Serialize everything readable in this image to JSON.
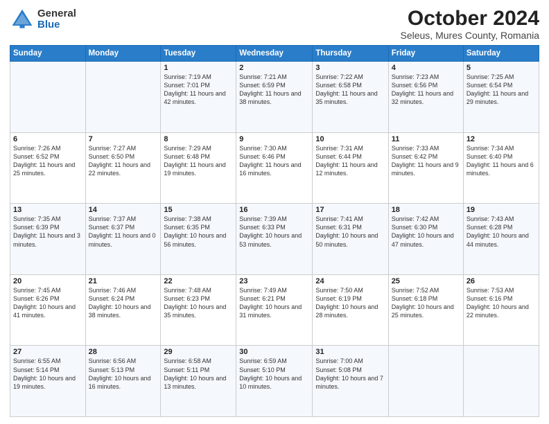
{
  "header": {
    "logo_general": "General",
    "logo_blue": "Blue",
    "month_title": "October 2024",
    "location": "Seleus, Mures County, Romania"
  },
  "days_of_week": [
    "Sunday",
    "Monday",
    "Tuesday",
    "Wednesday",
    "Thursday",
    "Friday",
    "Saturday"
  ],
  "weeks": [
    [
      {
        "day": "",
        "detail": ""
      },
      {
        "day": "",
        "detail": ""
      },
      {
        "day": "1",
        "detail": "Sunrise: 7:19 AM\nSunset: 7:01 PM\nDaylight: 11 hours and 42 minutes."
      },
      {
        "day": "2",
        "detail": "Sunrise: 7:21 AM\nSunset: 6:59 PM\nDaylight: 11 hours and 38 minutes."
      },
      {
        "day": "3",
        "detail": "Sunrise: 7:22 AM\nSunset: 6:58 PM\nDaylight: 11 hours and 35 minutes."
      },
      {
        "day": "4",
        "detail": "Sunrise: 7:23 AM\nSunset: 6:56 PM\nDaylight: 11 hours and 32 minutes."
      },
      {
        "day": "5",
        "detail": "Sunrise: 7:25 AM\nSunset: 6:54 PM\nDaylight: 11 hours and 29 minutes."
      }
    ],
    [
      {
        "day": "6",
        "detail": "Sunrise: 7:26 AM\nSunset: 6:52 PM\nDaylight: 11 hours and 25 minutes."
      },
      {
        "day": "7",
        "detail": "Sunrise: 7:27 AM\nSunset: 6:50 PM\nDaylight: 11 hours and 22 minutes."
      },
      {
        "day": "8",
        "detail": "Sunrise: 7:29 AM\nSunset: 6:48 PM\nDaylight: 11 hours and 19 minutes."
      },
      {
        "day": "9",
        "detail": "Sunrise: 7:30 AM\nSunset: 6:46 PM\nDaylight: 11 hours and 16 minutes."
      },
      {
        "day": "10",
        "detail": "Sunrise: 7:31 AM\nSunset: 6:44 PM\nDaylight: 11 hours and 12 minutes."
      },
      {
        "day": "11",
        "detail": "Sunrise: 7:33 AM\nSunset: 6:42 PM\nDaylight: 11 hours and 9 minutes."
      },
      {
        "day": "12",
        "detail": "Sunrise: 7:34 AM\nSunset: 6:40 PM\nDaylight: 11 hours and 6 minutes."
      }
    ],
    [
      {
        "day": "13",
        "detail": "Sunrise: 7:35 AM\nSunset: 6:39 PM\nDaylight: 11 hours and 3 minutes."
      },
      {
        "day": "14",
        "detail": "Sunrise: 7:37 AM\nSunset: 6:37 PM\nDaylight: 11 hours and 0 minutes."
      },
      {
        "day": "15",
        "detail": "Sunrise: 7:38 AM\nSunset: 6:35 PM\nDaylight: 10 hours and 56 minutes."
      },
      {
        "day": "16",
        "detail": "Sunrise: 7:39 AM\nSunset: 6:33 PM\nDaylight: 10 hours and 53 minutes."
      },
      {
        "day": "17",
        "detail": "Sunrise: 7:41 AM\nSunset: 6:31 PM\nDaylight: 10 hours and 50 minutes."
      },
      {
        "day": "18",
        "detail": "Sunrise: 7:42 AM\nSunset: 6:30 PM\nDaylight: 10 hours and 47 minutes."
      },
      {
        "day": "19",
        "detail": "Sunrise: 7:43 AM\nSunset: 6:28 PM\nDaylight: 10 hours and 44 minutes."
      }
    ],
    [
      {
        "day": "20",
        "detail": "Sunrise: 7:45 AM\nSunset: 6:26 PM\nDaylight: 10 hours and 41 minutes."
      },
      {
        "day": "21",
        "detail": "Sunrise: 7:46 AM\nSunset: 6:24 PM\nDaylight: 10 hours and 38 minutes."
      },
      {
        "day": "22",
        "detail": "Sunrise: 7:48 AM\nSunset: 6:23 PM\nDaylight: 10 hours and 35 minutes."
      },
      {
        "day": "23",
        "detail": "Sunrise: 7:49 AM\nSunset: 6:21 PM\nDaylight: 10 hours and 31 minutes."
      },
      {
        "day": "24",
        "detail": "Sunrise: 7:50 AM\nSunset: 6:19 PM\nDaylight: 10 hours and 28 minutes."
      },
      {
        "day": "25",
        "detail": "Sunrise: 7:52 AM\nSunset: 6:18 PM\nDaylight: 10 hours and 25 minutes."
      },
      {
        "day": "26",
        "detail": "Sunrise: 7:53 AM\nSunset: 6:16 PM\nDaylight: 10 hours and 22 minutes."
      }
    ],
    [
      {
        "day": "27",
        "detail": "Sunrise: 6:55 AM\nSunset: 5:14 PM\nDaylight: 10 hours and 19 minutes."
      },
      {
        "day": "28",
        "detail": "Sunrise: 6:56 AM\nSunset: 5:13 PM\nDaylight: 10 hours and 16 minutes."
      },
      {
        "day": "29",
        "detail": "Sunrise: 6:58 AM\nSunset: 5:11 PM\nDaylight: 10 hours and 13 minutes."
      },
      {
        "day": "30",
        "detail": "Sunrise: 6:59 AM\nSunset: 5:10 PM\nDaylight: 10 hours and 10 minutes."
      },
      {
        "day": "31",
        "detail": "Sunrise: 7:00 AM\nSunset: 5:08 PM\nDaylight: 10 hours and 7 minutes."
      },
      {
        "day": "",
        "detail": ""
      },
      {
        "day": "",
        "detail": ""
      }
    ]
  ]
}
